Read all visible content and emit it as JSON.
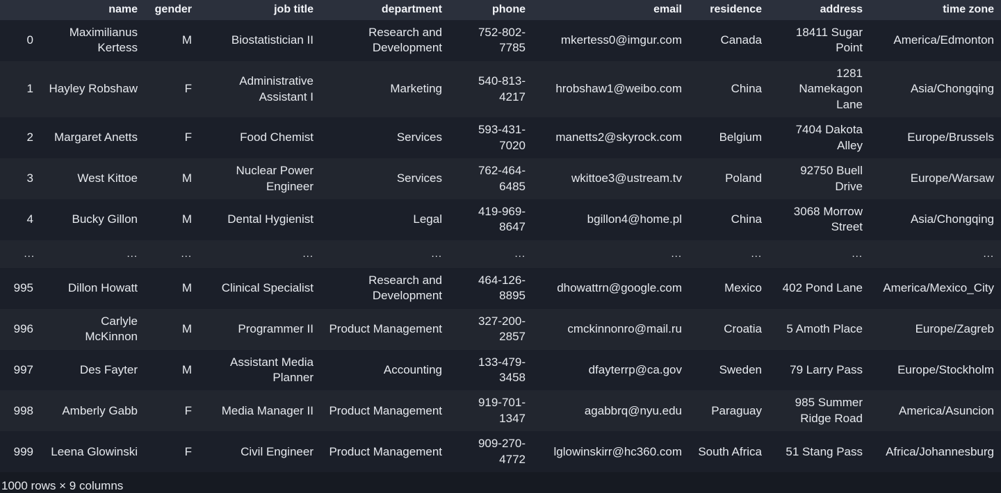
{
  "table": {
    "index_header": "",
    "columns": [
      "name",
      "gender",
      "job title",
      "department",
      "phone",
      "email",
      "residence",
      "address",
      "time zone"
    ],
    "ellipsis": "...",
    "rows": [
      {
        "index": "0",
        "name": "Maximilianus Kertess",
        "gender": "M",
        "job_title": "Biostatistician II",
        "department": "Research and Development",
        "phone": "752-802-7785",
        "email": "mkertess0@imgur.com",
        "residence": "Canada",
        "address": "18411 Sugar Point",
        "time_zone": "America/Edmonton"
      },
      {
        "index": "1",
        "name": "Hayley Robshaw",
        "gender": "F",
        "job_title": "Administrative Assistant I",
        "department": "Marketing",
        "phone": "540-813-4217",
        "email": "hrobshaw1@weibo.com",
        "residence": "China",
        "address": "1281 Namekagon Lane",
        "time_zone": "Asia/Chongqing"
      },
      {
        "index": "2",
        "name": "Margaret Anetts",
        "gender": "F",
        "job_title": "Food Chemist",
        "department": "Services",
        "phone": "593-431-7020",
        "email": "manetts2@skyrock.com",
        "residence": "Belgium",
        "address": "7404 Dakota Alley",
        "time_zone": "Europe/Brussels"
      },
      {
        "index": "3",
        "name": "West Kittoe",
        "gender": "M",
        "job_title": "Nuclear Power Engineer",
        "department": "Services",
        "phone": "762-464-6485",
        "email": "wkittoe3@ustream.tv",
        "residence": "Poland",
        "address": "92750 Buell Drive",
        "time_zone": "Europe/Warsaw"
      },
      {
        "index": "4",
        "name": "Bucky Gillon",
        "gender": "M",
        "job_title": "Dental Hygienist",
        "department": "Legal",
        "phone": "419-969-8647",
        "email": "bgillon4@home.pl",
        "residence": "China",
        "address": "3068 Morrow Street",
        "time_zone": "Asia/Chongqing"
      },
      {
        "index": "995",
        "name": "Dillon Howatt",
        "gender": "M",
        "job_title": "Clinical Specialist",
        "department": "Research and Development",
        "phone": "464-126-8895",
        "email": "dhowattrn@google.com",
        "residence": "Mexico",
        "address": "402 Pond Lane",
        "time_zone": "America/Mexico_City"
      },
      {
        "index": "996",
        "name": "Carlyle McKinnon",
        "gender": "M",
        "job_title": "Programmer II",
        "department": "Product Management",
        "phone": "327-200-2857",
        "email": "cmckinnonro@mail.ru",
        "residence": "Croatia",
        "address": "5 Amoth Place",
        "time_zone": "Europe/Zagreb"
      },
      {
        "index": "997",
        "name": "Des Fayter",
        "gender": "M",
        "job_title": "Assistant Media Planner",
        "department": "Accounting",
        "phone": "133-479-3458",
        "email": "dfayterrp@ca.gov",
        "residence": "Sweden",
        "address": "79 Larry Pass",
        "time_zone": "Europe/Stockholm"
      },
      {
        "index": "998",
        "name": "Amberly Gabb",
        "gender": "F",
        "job_title": "Media Manager II",
        "department": "Product Management",
        "phone": "919-701-1347",
        "email": "agabbrq@nyu.edu",
        "residence": "Paraguay",
        "address": "985 Summer Ridge Road",
        "time_zone": "America/Asuncion"
      },
      {
        "index": "999",
        "name": "Leena Glowinski",
        "gender": "F",
        "job_title": "Civil Engineer",
        "department": "Product Management",
        "phone": "909-270-4772",
        "email": "lglowinskirr@hc360.com",
        "residence": "South Africa",
        "address": "51 Stang Pass",
        "time_zone": "Africa/Johannesburg"
      }
    ],
    "ellipsis_row_after_index": 4
  },
  "footer": {
    "summary": "1000 rows × 9 columns"
  },
  "colors": {
    "background": "#161a22",
    "header_bg": "#2b303c",
    "row_even_bg": "#1b1f29",
    "row_odd_bg": "#22262f",
    "text": "#e6e9ee"
  }
}
